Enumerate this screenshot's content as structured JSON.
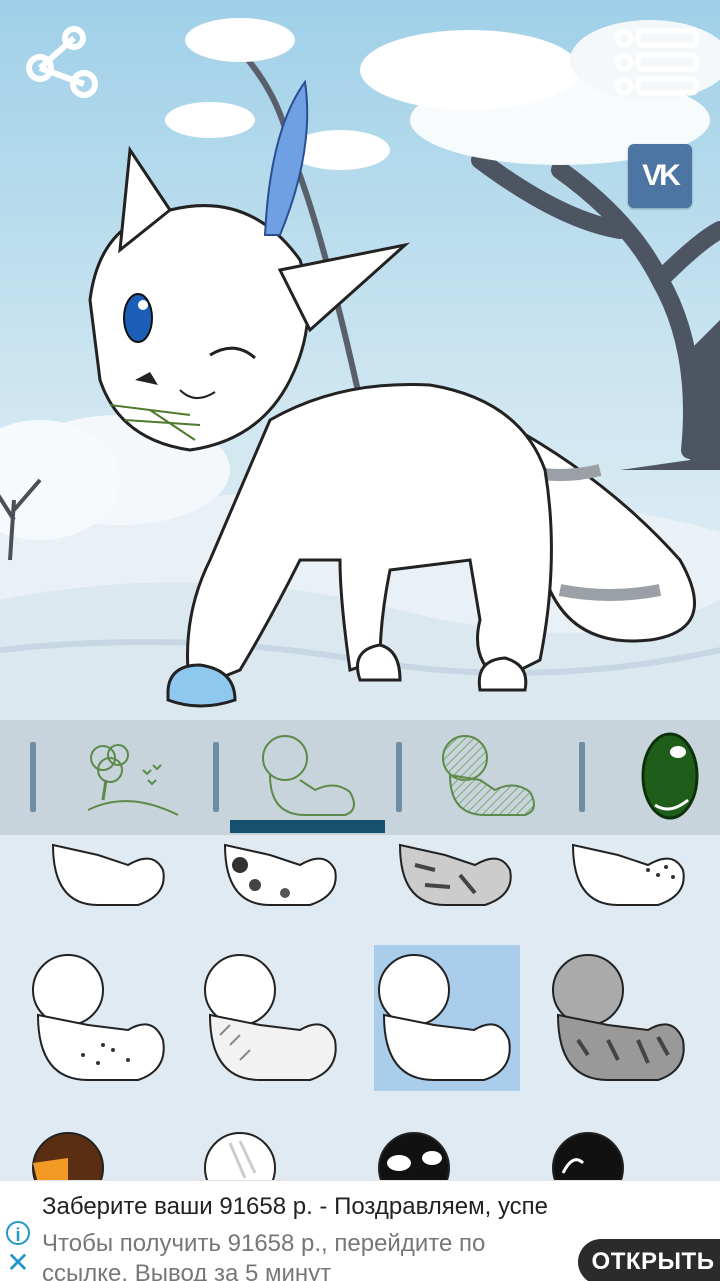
{
  "top_buttons": {
    "share": "share-icon",
    "menu": "menu-list-icon",
    "vk": "vk-icon",
    "vk_label": "VK"
  },
  "tabs": [
    {
      "name": "background",
      "icon": "tree-landscape-icon",
      "selected": false
    },
    {
      "name": "body-outline",
      "icon": "body-outline-icon",
      "selected": true
    },
    {
      "name": "body-shading",
      "icon": "body-shading-icon",
      "selected": false
    },
    {
      "name": "eyes",
      "icon": "eye-icon",
      "selected": false
    }
  ],
  "colors": {
    "tabbar": "#c8d4dc",
    "indicator": "#15506f",
    "selected_cell": "#a9cdea",
    "grid_bg": "#dfeaf2",
    "vk": "#4c75a3",
    "ad_accent": "#2196c9"
  },
  "grid_items": [
    {
      "name": "fur-pattern-plain",
      "selected": false
    },
    {
      "name": "fur-pattern-dark-spots",
      "selected": false
    },
    {
      "name": "fur-pattern-striped-grey",
      "selected": false
    },
    {
      "name": "fur-pattern-dotted",
      "selected": false
    },
    {
      "name": "fur-pattern-speckled",
      "selected": false
    },
    {
      "name": "fur-pattern-fluffy",
      "selected": false
    },
    {
      "name": "fur-pattern-long-fur",
      "selected": true
    },
    {
      "name": "fur-pattern-tabby-grey",
      "selected": false
    },
    {
      "name": "fur-pattern-brown-orange",
      "selected": false
    },
    {
      "name": "fur-pattern-white-cream",
      "selected": false
    },
    {
      "name": "fur-pattern-black-white",
      "selected": false
    },
    {
      "name": "fur-pattern-black",
      "selected": false
    }
  ],
  "ad": {
    "title": "Заберите ваши 91658 р. - Поздравляем, успе",
    "description": "Чтобы получить 91658 р., перейдите по ссылке. Вывод за 5 минут",
    "cta": "ОТКРЫТЬ",
    "info_icon": "info-icon",
    "close_icon": "close-icon"
  }
}
